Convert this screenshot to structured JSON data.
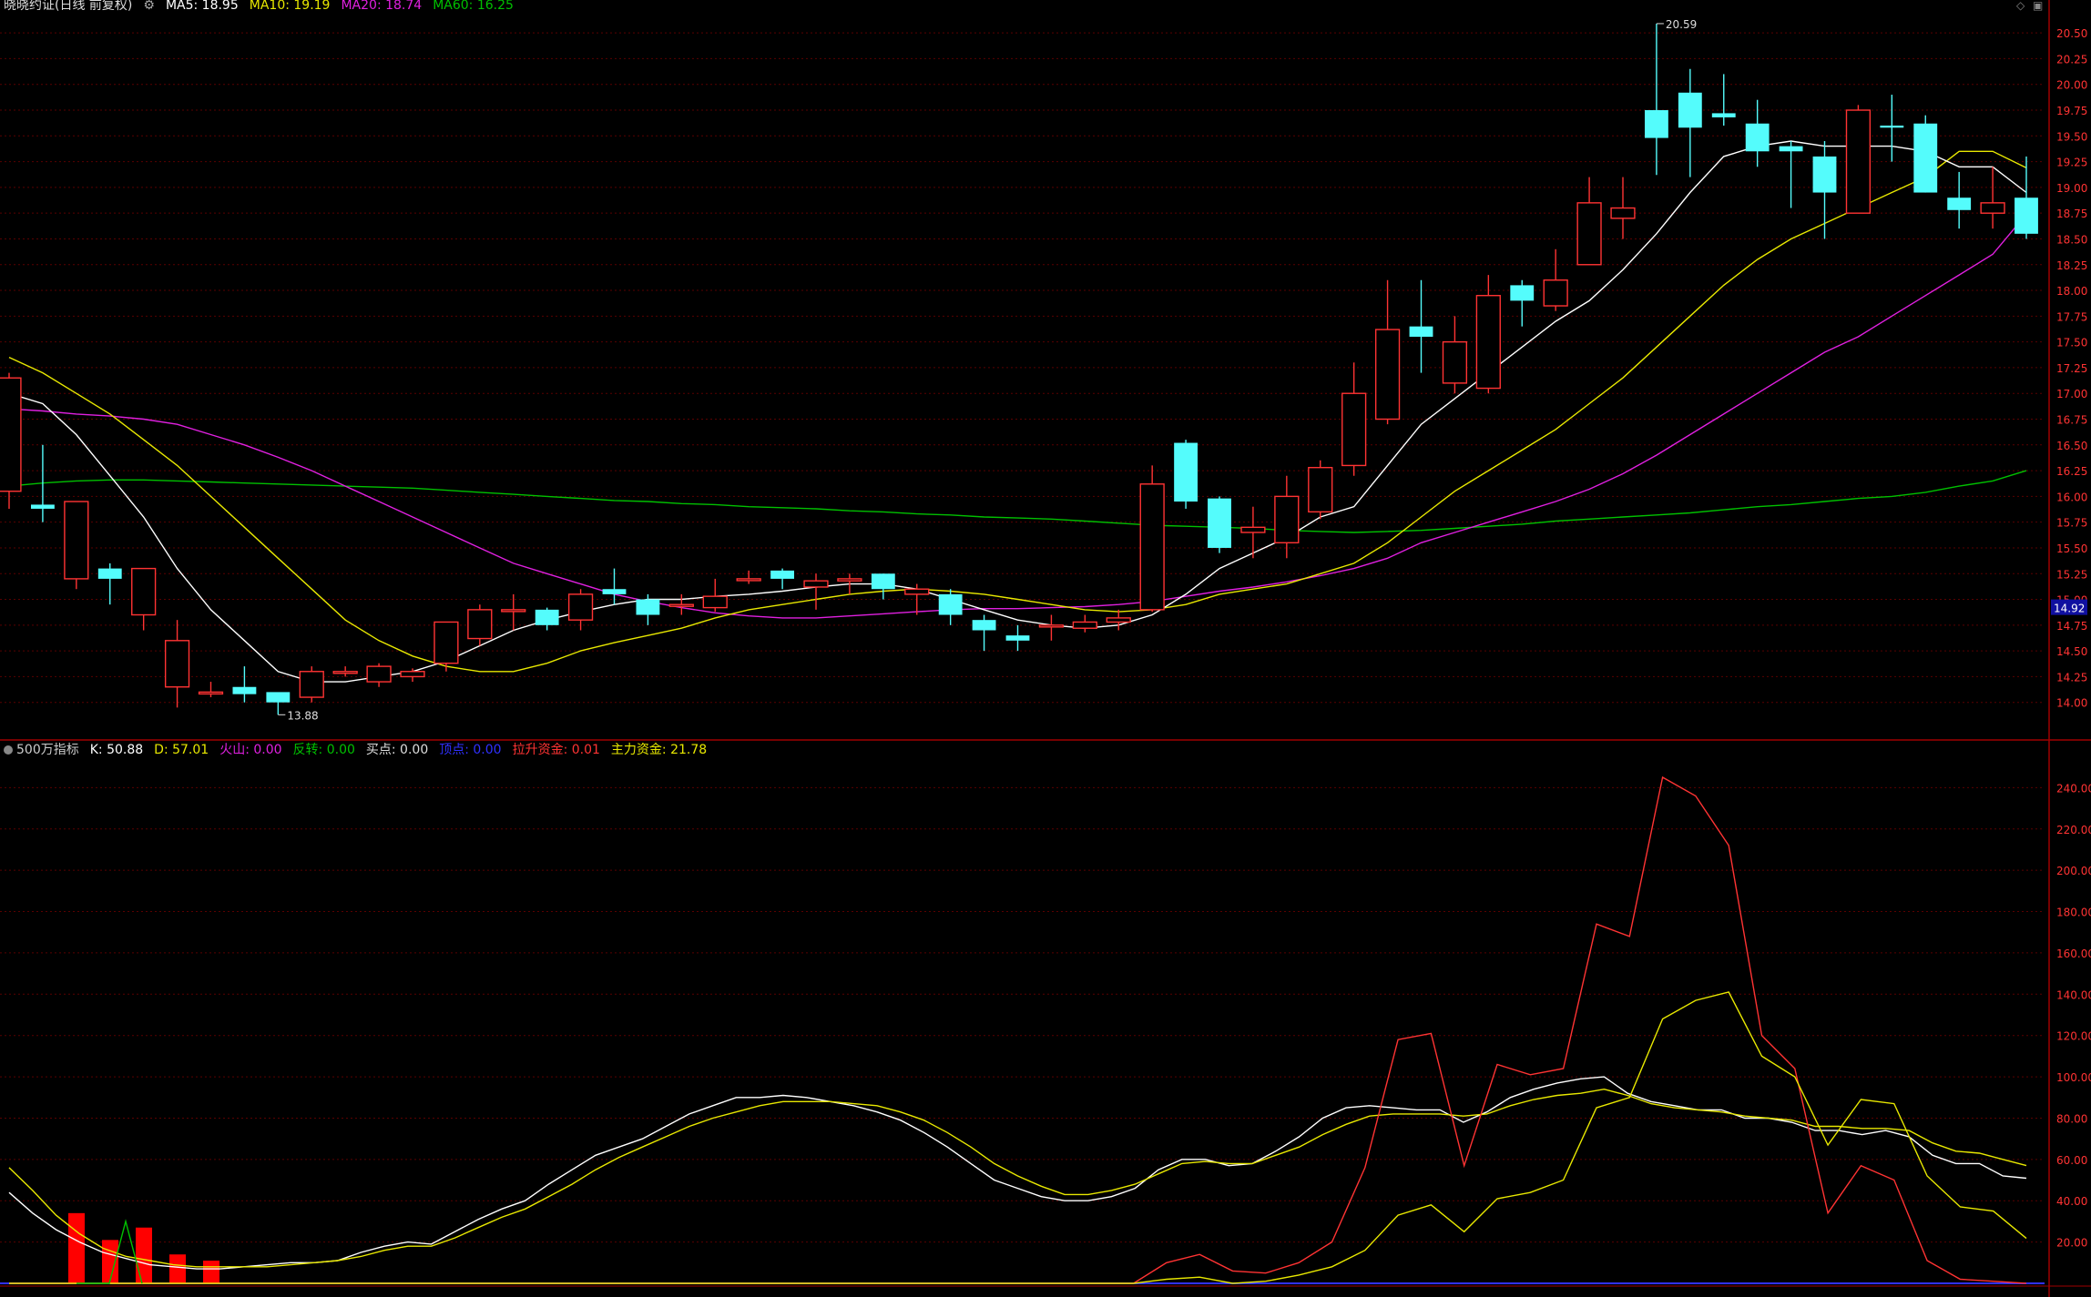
{
  "colors": {
    "up": "#ff3333",
    "down": "#54fcfc",
    "ma5": "#ffffff",
    "ma10": "#e8e800",
    "ma20": "#e020e0",
    "ma60": "#00c000",
    "grid": "#5a0000",
    "axis_text": "#ff3333"
  },
  "header": {
    "title": "晓晓约证(日线 前复权)",
    "ma": [
      {
        "label": "MA5: 18.95",
        "color": "#ffffff"
      },
      {
        "label": "MA10: 19.19",
        "color": "#e8e800"
      },
      {
        "label": "MA20: 18.74",
        "color": "#e020e0"
      },
      {
        "label": "MA60: 16.25",
        "color": "#00c000"
      }
    ]
  },
  "indicator_header": {
    "name": "500万指标",
    "items": [
      {
        "label": "K: 50.88",
        "color": "#ffffff"
      },
      {
        "label": "D: 57.01",
        "color": "#e8e800"
      },
      {
        "label": "火山: 0.00",
        "color": "#e020e0"
      },
      {
        "label": "反转: 0.00",
        "color": "#00c000"
      },
      {
        "label": "买点: 0.00",
        "color": "#dddddd"
      },
      {
        "label": "顶点: 0.00",
        "color": "#3030ff"
      },
      {
        "label": "拉升资金: 0.01",
        "color": "#ff3333"
      },
      {
        "label": "主力资金: 21.78",
        "color": "#e8e800"
      }
    ]
  },
  "chart_data": [
    {
      "type": "candlestick",
      "ylim": [
        13.75,
        20.625
      ],
      "yticks": [
        14.0,
        14.25,
        14.5,
        14.75,
        15.0,
        15.25,
        15.5,
        15.75,
        16.0,
        16.25,
        16.5,
        16.75,
        17.0,
        17.25,
        17.5,
        17.75,
        18.0,
        18.25,
        18.5,
        18.75,
        19.0,
        19.25,
        19.5,
        19.75,
        20.0,
        20.25,
        20.5
      ],
      "current_price": "14.92",
      "high_label": "20.59",
      "low_label": "13.88",
      "candles": [
        [
          16.05,
          17.15,
          15.88,
          17.2
        ],
        [
          15.92,
          15.88,
          15.75,
          16.5
        ],
        [
          15.2,
          15.95,
          15.1,
          15.95
        ],
        [
          15.3,
          15.2,
          14.95,
          15.35
        ],
        [
          14.85,
          15.3,
          14.7,
          15.3
        ],
        [
          14.15,
          14.6,
          13.95,
          14.8
        ],
        [
          14.1,
          14.1,
          14.05,
          14.2
        ],
        [
          14.15,
          14.08,
          14.0,
          14.35
        ],
        [
          14.1,
          14.0,
          13.88,
          14.05
        ],
        [
          14.05,
          14.3,
          14.0,
          14.35
        ],
        [
          14.3,
          14.3,
          14.25,
          14.35
        ],
        [
          14.2,
          14.35,
          14.15,
          14.38
        ],
        [
          14.25,
          14.3,
          14.2,
          14.33
        ],
        [
          14.38,
          14.78,
          14.3,
          14.78
        ],
        [
          14.62,
          14.9,
          14.55,
          14.95
        ],
        [
          14.9,
          14.9,
          14.7,
          15.05
        ],
        [
          14.9,
          14.75,
          14.7,
          14.92
        ],
        [
          14.8,
          15.05,
          14.7,
          15.1
        ],
        [
          15.1,
          15.05,
          14.95,
          15.3
        ],
        [
          15.0,
          14.85,
          14.75,
          15.05
        ],
        [
          14.95,
          14.95,
          14.85,
          15.05
        ],
        [
          14.92,
          15.03,
          14.88,
          15.2
        ],
        [
          15.2,
          15.2,
          15.15,
          15.28
        ],
        [
          15.28,
          15.2,
          15.1,
          15.3
        ],
        [
          15.12,
          15.18,
          14.9,
          15.25
        ],
        [
          15.18,
          15.2,
          15.05,
          15.25
        ],
        [
          15.25,
          15.1,
          15.0,
          15.25
        ],
        [
          15.05,
          15.1,
          14.85,
          15.15
        ],
        [
          15.05,
          14.85,
          14.75,
          15.1
        ],
        [
          14.8,
          14.7,
          14.5,
          14.85
        ],
        [
          14.65,
          14.6,
          14.5,
          14.75
        ],
        [
          14.75,
          14.75,
          14.6,
          14.85
        ],
        [
          14.72,
          14.78,
          14.68,
          14.85
        ],
        [
          14.78,
          14.82,
          14.7,
          14.9
        ],
        [
          14.9,
          16.12,
          14.88,
          16.3
        ],
        [
          16.52,
          15.95,
          15.88,
          16.55
        ],
        [
          15.98,
          15.5,
          15.45,
          16.0
        ],
        [
          15.65,
          15.7,
          15.4,
          15.9
        ],
        [
          15.55,
          16.0,
          15.4,
          16.2
        ],
        [
          15.85,
          16.28,
          15.78,
          16.35
        ],
        [
          16.3,
          17.0,
          16.2,
          17.3
        ],
        [
          16.75,
          17.62,
          16.7,
          18.1
        ],
        [
          17.65,
          17.55,
          17.2,
          18.1
        ],
        [
          17.1,
          17.5,
          17.0,
          17.75
        ],
        [
          17.05,
          17.95,
          17.0,
          18.15
        ],
        [
          18.05,
          17.9,
          17.65,
          18.1
        ],
        [
          17.85,
          18.1,
          17.8,
          18.4
        ],
        [
          18.25,
          18.85,
          18.25,
          19.1
        ],
        [
          18.7,
          18.8,
          18.5,
          19.1
        ],
        [
          19.75,
          19.48,
          19.12,
          20.59
        ],
        [
          19.92,
          19.58,
          19.1,
          20.15
        ],
        [
          19.72,
          19.68,
          19.6,
          20.1
        ],
        [
          19.62,
          19.35,
          19.2,
          19.85
        ],
        [
          19.4,
          19.35,
          18.8,
          19.45
        ],
        [
          19.3,
          18.95,
          18.5,
          19.45
        ],
        [
          18.75,
          19.75,
          18.75,
          19.8
        ],
        [
          19.6,
          19.58,
          19.25,
          19.9
        ],
        [
          19.62,
          18.95,
          18.95,
          19.7
        ],
        [
          18.9,
          18.78,
          18.6,
          19.15
        ],
        [
          18.75,
          18.85,
          18.6,
          19.2
        ],
        [
          18.9,
          18.55,
          18.5,
          19.3
        ]
      ],
      "ma5": [
        17.0,
        16.9,
        16.6,
        16.2,
        15.8,
        15.3,
        14.9,
        14.6,
        14.3,
        14.2,
        14.2,
        14.25,
        14.3,
        14.4,
        14.55,
        14.7,
        14.8,
        14.88,
        14.95,
        15.0,
        15.0,
        15.03,
        15.05,
        15.08,
        15.12,
        15.15,
        15.15,
        15.1,
        15.0,
        14.9,
        14.8,
        14.75,
        14.72,
        14.75,
        14.85,
        15.05,
        15.3,
        15.45,
        15.6,
        15.8,
        15.9,
        16.3,
        16.7,
        16.95,
        17.2,
        17.45,
        17.7,
        17.9,
        18.2,
        18.55,
        18.95,
        19.3,
        19.4,
        19.45,
        19.4,
        19.4,
        19.4,
        19.35,
        19.2,
        19.2,
        18.95
      ],
      "ma10": [
        17.35,
        17.2,
        17.0,
        16.8,
        16.55,
        16.3,
        16.0,
        15.7,
        15.4,
        15.1,
        14.8,
        14.6,
        14.45,
        14.35,
        14.3,
        14.3,
        14.38,
        14.5,
        14.58,
        14.65,
        14.72,
        14.82,
        14.9,
        14.95,
        15.0,
        15.05,
        15.08,
        15.1,
        15.08,
        15.05,
        15.0,
        14.95,
        14.9,
        14.88,
        14.9,
        14.95,
        15.05,
        15.1,
        15.15,
        15.25,
        15.35,
        15.55,
        15.8,
        16.05,
        16.25,
        16.45,
        16.65,
        16.9,
        17.15,
        17.45,
        17.75,
        18.05,
        18.3,
        18.5,
        18.65,
        18.8,
        18.95,
        19.1,
        19.35,
        19.35,
        19.19
      ],
      "ma20": [
        16.85,
        16.83,
        16.8,
        16.78,
        16.75,
        16.7,
        16.6,
        16.5,
        16.38,
        16.25,
        16.1,
        15.95,
        15.8,
        15.65,
        15.5,
        15.35,
        15.25,
        15.15,
        15.05,
        14.98,
        14.92,
        14.87,
        14.84,
        14.82,
        14.82,
        14.84,
        14.86,
        14.88,
        14.9,
        14.91,
        14.91,
        14.92,
        14.93,
        14.95,
        14.98,
        15.03,
        15.08,
        15.12,
        15.17,
        15.23,
        15.3,
        15.4,
        15.55,
        15.65,
        15.75,
        15.85,
        15.95,
        16.07,
        16.22,
        16.4,
        16.6,
        16.8,
        17.0,
        17.2,
        17.4,
        17.55,
        17.75,
        17.95,
        18.15,
        18.35,
        18.74
      ],
      "ma60": [
        16.1,
        16.13,
        16.15,
        16.16,
        16.16,
        16.15,
        16.14,
        16.13,
        16.12,
        16.11,
        16.1,
        16.09,
        16.08,
        16.06,
        16.04,
        16.02,
        16.0,
        15.98,
        15.96,
        15.95,
        15.93,
        15.92,
        15.9,
        15.89,
        15.88,
        15.86,
        15.85,
        15.83,
        15.82,
        15.8,
        15.79,
        15.78,
        15.76,
        15.74,
        15.72,
        15.71,
        15.7,
        15.69,
        15.67,
        15.66,
        15.65,
        15.66,
        15.67,
        15.69,
        15.71,
        15.73,
        15.76,
        15.78,
        15.8,
        15.82,
        15.84,
        15.87,
        15.9,
        15.92,
        15.95,
        15.98,
        16.0,
        16.04,
        16.1,
        16.15,
        16.25
      ]
    },
    {
      "type": "line",
      "ylim": [
        0,
        260
      ],
      "yticks": [
        20,
        40,
        60,
        80,
        100,
        120,
        140,
        160,
        180,
        200,
        220,
        240
      ],
      "series": [
        {
          "name": "K",
          "color": "#ffffff",
          "values": [
            44,
            34,
            26,
            20,
            15,
            12,
            9,
            8,
            7,
            7,
            8,
            9,
            10,
            10,
            11,
            15,
            18,
            20,
            19,
            25,
            31,
            36,
            40,
            48,
            55,
            62,
            66,
            70,
            76,
            82,
            86,
            90,
            90,
            91,
            90,
            88,
            86,
            83,
            79,
            73,
            66,
            58,
            50,
            46,
            42,
            40,
            40,
            42,
            46,
            55,
            60,
            60,
            57,
            58,
            64,
            71,
            80,
            85,
            86,
            85,
            84,
            84,
            78,
            83,
            90,
            94,
            97,
            99,
            100,
            92,
            88,
            86,
            84,
            84,
            80,
            80,
            78,
            74,
            74,
            72,
            74,
            71,
            62,
            58,
            58,
            52,
            50.88
          ]
        },
        {
          "name": "D",
          "color": "#e8e800",
          "values": [
            56,
            45,
            33,
            24,
            17,
            13,
            11,
            9,
            8,
            8,
            8,
            8,
            9,
            10,
            11,
            13,
            16,
            18,
            18,
            22,
            27,
            32,
            36,
            42,
            48,
            55,
            61,
            66,
            71,
            76,
            80,
            83,
            86,
            88,
            88,
            88,
            87,
            86,
            83,
            79,
            73,
            66,
            58,
            52,
            47,
            43,
            43,
            45,
            48,
            53,
            58,
            59,
            58,
            58,
            62,
            66,
            72,
            77,
            81,
            82,
            82,
            82,
            81,
            82,
            86,
            89,
            91,
            92,
            94,
            91,
            87,
            85,
            84,
            83,
            81,
            80,
            79,
            76,
            76,
            75,
            75,
            74,
            68,
            64,
            63,
            60,
            57.01
          ]
        },
        {
          "name": "拉升资金",
          "color": "#ff3333",
          "values": [
            0,
            0,
            0,
            0,
            0,
            0,
            0,
            0,
            0,
            0,
            0,
            0,
            0,
            0,
            0,
            0,
            0,
            0,
            0,
            0,
            0,
            0,
            0,
            0,
            0,
            0,
            0,
            0,
            0,
            0,
            0,
            0,
            0,
            0,
            0,
            10,
            14,
            6,
            5,
            10,
            20,
            56,
            118,
            121,
            57,
            106,
            101,
            104,
            174,
            168,
            245,
            236,
            212,
            120,
            104,
            34,
            57,
            50,
            11,
            2,
            1,
            0.01
          ]
        },
        {
          "name": "主力资金",
          "color": "#e8e800",
          "values": [
            0,
            0,
            0,
            0,
            0,
            0,
            0,
            0,
            0,
            0,
            0,
            0,
            0,
            0,
            0,
            0,
            0,
            0,
            0,
            0,
            0,
            0,
            0,
            0,
            0,
            0,
            0,
            0,
            0,
            0,
            0,
            0,
            0,
            0,
            0,
            2,
            3,
            0,
            1,
            4,
            8,
            16,
            33,
            38,
            25,
            41,
            44,
            50,
            85,
            90,
            128,
            137,
            141,
            110,
            100,
            67,
            89,
            87,
            52,
            37,
            35,
            21.78
          ]
        },
        {
          "name": "反转",
          "color": "#00c000",
          "values": [
            0,
            0,
            0,
            30,
            0
          ]
        }
      ],
      "bars": [
        34,
        21,
        27,
        14,
        11,
        0
      ],
      "bar_color": "#ff0000"
    }
  ]
}
